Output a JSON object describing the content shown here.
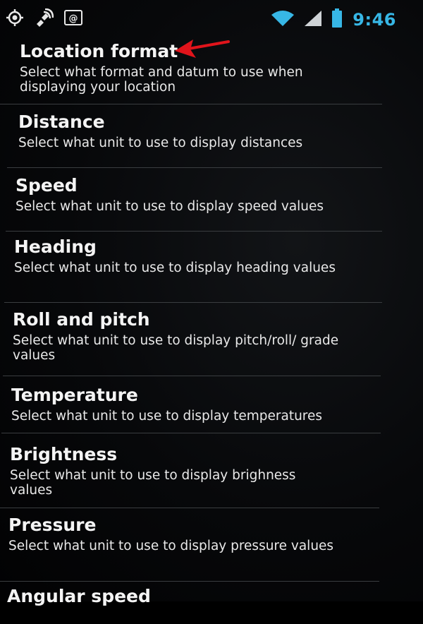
{
  "status_bar": {
    "left_icons": [
      "gps-icon",
      "satellite-signal-icon",
      "email-notification-icon"
    ],
    "right_icons": [
      "wifi-icon",
      "cell-signal-icon",
      "battery-icon"
    ],
    "time": "9:46",
    "accent_color": "#37b7e6"
  },
  "settings": {
    "items": [
      {
        "title": "Location format",
        "summary": "Select what format and datum to use when displaying your location"
      },
      {
        "title": "Distance",
        "summary": "Select what unit to use to display distances"
      },
      {
        "title": "Speed",
        "summary": "Select what unit to use to display speed values"
      },
      {
        "title": "Heading",
        "summary": "Select what unit to use to display heading values"
      },
      {
        "title": "Roll and pitch",
        "summary": "Select what unit to use to display pitch/roll/ grade values"
      },
      {
        "title": "Temperature",
        "summary": "Select what unit to use to display temperatures"
      },
      {
        "title": "Brightness",
        "summary": "Select what unit to use to display brighness values"
      },
      {
        "title": "Pressure",
        "summary": "Select what unit to use to display pressure values"
      },
      {
        "title": "Angular speed",
        "summary": ""
      }
    ]
  },
  "annotation": {
    "arrow_color": "#e0141b",
    "points_to": "Location format"
  }
}
